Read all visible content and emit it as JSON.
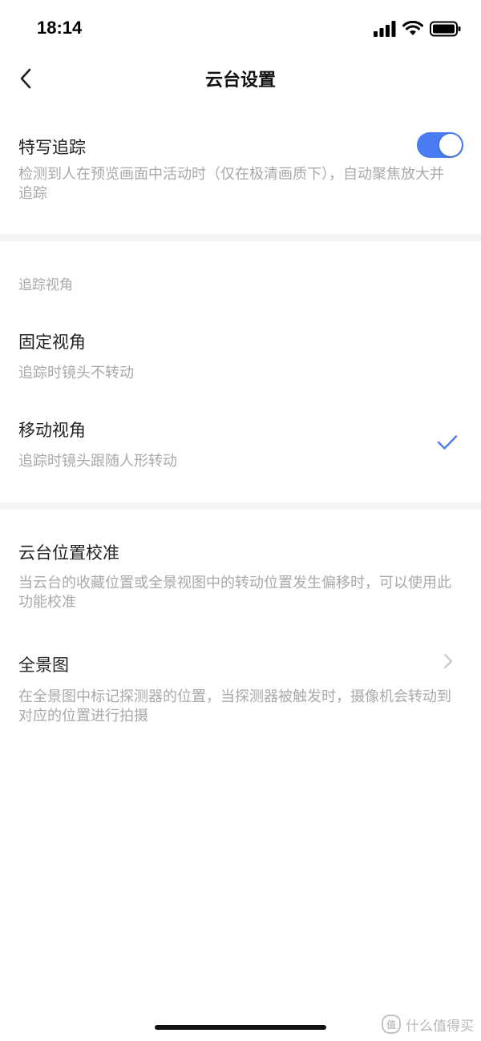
{
  "status_bar": {
    "time": "18:14"
  },
  "nav": {
    "title": "云台设置"
  },
  "close_up_tracking": {
    "title": "特写追踪",
    "description": "检测到人在预览画面中活动时（仅在极清画质下），自动聚焦放大并追踪",
    "enabled": true
  },
  "tracking_view": {
    "label": "追踪视角",
    "options": [
      {
        "title": "固定视角",
        "description": "追踪时镜头不转动",
        "selected": false
      },
      {
        "title": "移动视角",
        "description": "追踪时镜头跟随人形转动",
        "selected": true
      }
    ]
  },
  "calibration": {
    "title": "云台位置校准",
    "description": "当云台的收藏位置或全景视图中的转动位置发生偏移时，可以使用此功能校准"
  },
  "panorama": {
    "title": "全景图",
    "description": "在全景图中标记探测器的位置，当探测器被触发时，摄像机会转动到对应的位置进行拍摄"
  },
  "watermark": {
    "text": "什么值得买",
    "logo_text": "值"
  },
  "colors": {
    "accent": "#4a7cf1",
    "divider": "#f4f4f4",
    "secondary_text": "#a9a9a9"
  }
}
